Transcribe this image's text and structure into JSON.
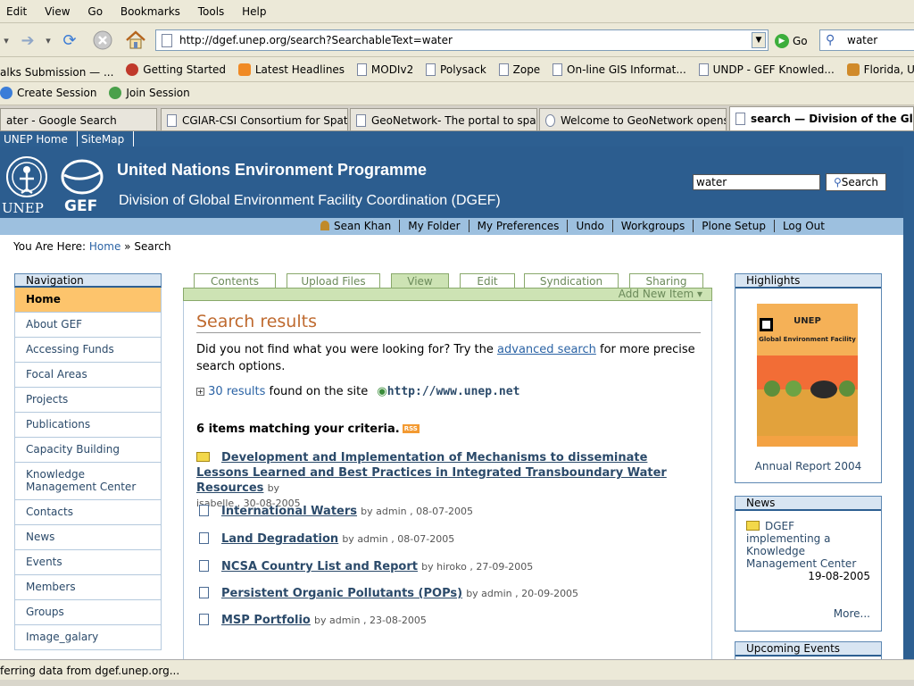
{
  "browser": {
    "menu": [
      "Edit",
      "View",
      "Go",
      "Bookmarks",
      "Tools",
      "Help"
    ],
    "url": "http://dgef.unep.org/search?SearchableText=water",
    "go_label": "Go",
    "search_value": "water",
    "bookmarks": [
      {
        "label": "alks Submission — ...",
        "icon": "none"
      },
      {
        "label": "Getting Started",
        "icon": "firefox-icon"
      },
      {
        "label": "Latest Headlines",
        "icon": "rss-icon"
      },
      {
        "label": "MODIv2",
        "icon": "page-icon"
      },
      {
        "label": "Polysack",
        "icon": "page-icon"
      },
      {
        "label": "Zope",
        "icon": "page-icon"
      },
      {
        "label": "On-line GIS Informat...",
        "icon": "page-icon"
      },
      {
        "label": "UNDP - GEF Knowled...",
        "icon": "page-icon"
      },
      {
        "label": "Florida, United State...",
        "icon": "weather-icon"
      }
    ],
    "collab": [
      "Create Session",
      "Join Session"
    ],
    "tabs": [
      {
        "label": "ater - Google Search",
        "active": false
      },
      {
        "label": "CGIAR-CSI Consortium for Spati...",
        "active": false
      },
      {
        "label": "GeoNetwork- The portal to spati...",
        "active": false
      },
      {
        "label": "Welcome to GeoNetwork openso...",
        "active": false
      },
      {
        "label": "search — Division of the Glo...",
        "active": true
      }
    ],
    "status": "ferring data from dgef.unep.org..."
  },
  "site": {
    "top_links": [
      "UNEP Home",
      "SiteMap"
    ],
    "title": "United Nations Environment Programme",
    "subtitle": "Division of Global Environment Facility Coordination (DGEF)",
    "logo_unep": "UNEP",
    "logo_gef": "GEF",
    "search_value": "water",
    "search_button": "Search",
    "personal": [
      "Sean Khan",
      "My Folder",
      "My Preferences",
      "Undo",
      "Workgroups",
      "Plone Setup",
      "Log Out"
    ],
    "breadcrumb_prefix": "You Are Here:",
    "breadcrumb_home": "Home",
    "breadcrumb_sep": "»",
    "breadcrumb_current": "Search"
  },
  "nav": {
    "header": "Navigation",
    "items": [
      "Home",
      "About GEF",
      "Accessing Funds",
      "Focal Areas",
      "Projects",
      "Publications",
      "Capacity Building",
      "Knowledge Management Center",
      "Contacts",
      "News",
      "Events",
      "Members",
      "Groups",
      "Image_galary"
    ]
  },
  "content_tabs": {
    "items": [
      "Contents",
      "Upload Files",
      "View",
      "Edit",
      "Syndication",
      "Sharing"
    ],
    "selected": "View",
    "add_new": "Add New Item ▾"
  },
  "results": {
    "heading": "Search results",
    "lead_before": "Did you not find what you were looking for? Try the",
    "lead_link": "advanced search",
    "lead_after": "for more precise search options.",
    "site_count": "30",
    "site_results_word": "results",
    "site_found_text": "found on the site",
    "site_url": "http://www.unep.net",
    "match_heading": "6 items matching your criteria.",
    "rss": "RSS",
    "items": [
      {
        "title": "Development and Implementation of Mechanisms to disseminate Lessons Learned and Best Practices in Integrated Transboundary Water Resources",
        "meta_by": "by",
        "meta": "isabelle , 30-08-2005",
        "icon": "folder-icon"
      },
      {
        "title": "International Waters",
        "meta": "by admin , 08-07-2005",
        "icon": "document-icon"
      },
      {
        "title": "Land Degradation",
        "meta": "by admin , 08-07-2005",
        "icon": "document-icon"
      },
      {
        "title": "NCSA Country List and Report",
        "meta": "by hiroko , 27-09-2005",
        "icon": "document-icon"
      },
      {
        "title": "Persistent Organic Pollutants (POPs)",
        "meta": "by admin , 20-09-2005",
        "icon": "document-icon"
      },
      {
        "title": "MSP Portfolio",
        "meta": "by admin , 23-08-2005",
        "icon": "document-icon"
      }
    ]
  },
  "highlights": {
    "header": "Highlights",
    "cover_title": "UNEP",
    "cover_sub": "Global Environment Facility",
    "caption": "Annual Report 2004"
  },
  "news": {
    "header": "News",
    "item": "DGEF implementing a Knowledge Management Center",
    "date": "19-08-2005",
    "more": "More..."
  },
  "events": {
    "header": "Upcoming Events"
  }
}
